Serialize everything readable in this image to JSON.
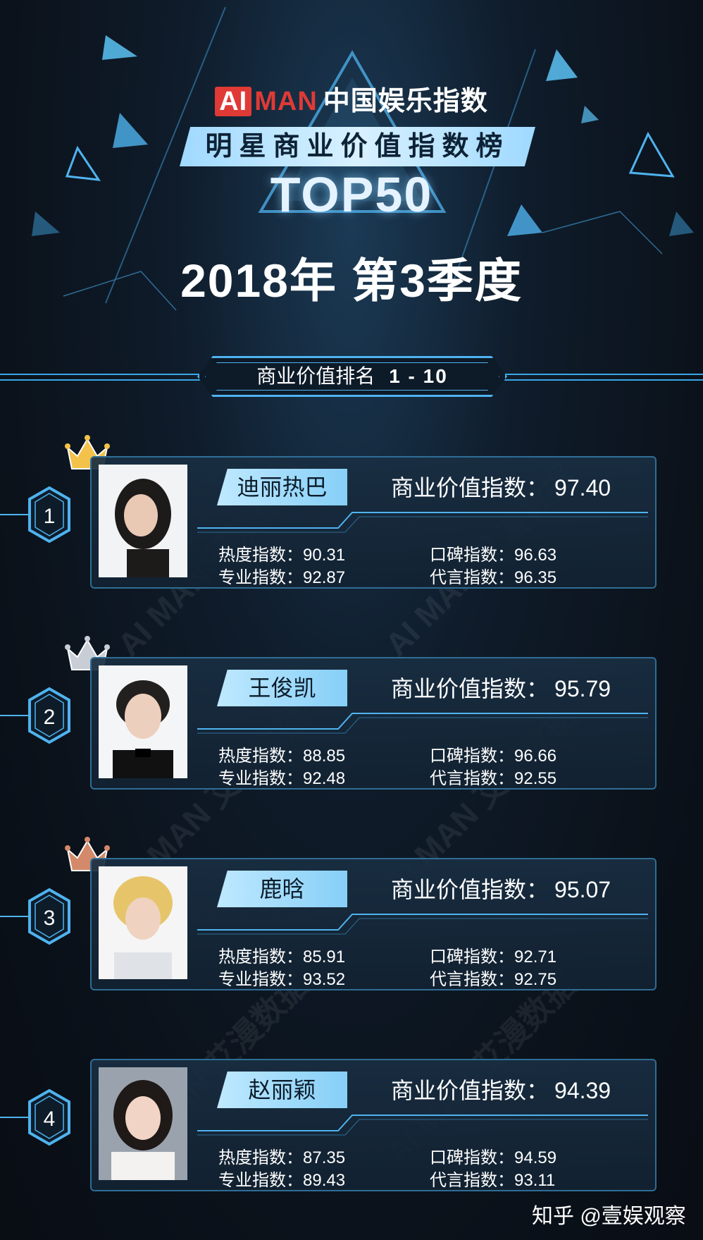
{
  "header": {
    "brand_ai": "AI",
    "brand_man": "MAN",
    "brand_cn": "中国娱乐指数",
    "banner": "明星商业价值指数榜",
    "top": "TOP50",
    "season": "2018年 第3季度"
  },
  "section": {
    "label": "商业价值排名",
    "range": "1 - 10"
  },
  "labels": {
    "score": "商业价值指数：",
    "heat": "热度指数：",
    "reputation": "口碑指数：",
    "professional": "专业指数：",
    "endorsement": "代言指数："
  },
  "rankings": [
    {
      "rank": "1",
      "name": "迪丽热巴",
      "score": "97.40",
      "heat": "90.31",
      "reputation": "96.63",
      "professional": "92.87",
      "endorsement": "96.35",
      "crown": "gold"
    },
    {
      "rank": "2",
      "name": "王俊凯",
      "score": "95.79",
      "heat": "88.85",
      "reputation": "96.66",
      "professional": "92.48",
      "endorsement": "92.55",
      "crown": "silver"
    },
    {
      "rank": "3",
      "name": "鹿晗",
      "score": "95.07",
      "heat": "85.91",
      "reputation": "92.71",
      "professional": "93.52",
      "endorsement": "92.75",
      "crown": "bronze"
    },
    {
      "rank": "4",
      "name": "赵丽颖",
      "score": "94.39",
      "heat": "87.35",
      "reputation": "94.59",
      "professional": "89.43",
      "endorsement": "93.11",
      "crown": ""
    }
  ],
  "watermark": "AI MAN 艾漫数据",
  "credit": "知乎 @壹娱观察",
  "colors": {
    "accent": "#4fb3ef",
    "brand_red": "#e03a36",
    "gold": "#f3c24a",
    "silver": "#c9ced6",
    "bronze": "#d48a6a"
  }
}
